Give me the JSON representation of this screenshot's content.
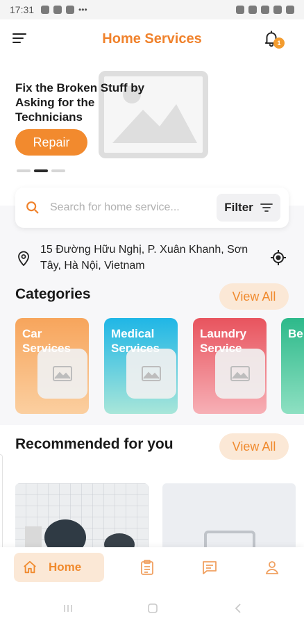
{
  "status_bar": {
    "time": "17:31"
  },
  "header": {
    "title": "Home Services",
    "notification_count": "1"
  },
  "banner": {
    "headline": "Fix the Broken Stuff by Asking for the Technicians",
    "cta_label": "Repair"
  },
  "search": {
    "placeholder": "Search for home service...",
    "filter_label": "Filter"
  },
  "location": {
    "address": "15 Đường Hữu Nghị, P. Xuân Khanh, Sơn Tây, Hà Nội, Vietnam"
  },
  "categories": {
    "title": "Categories",
    "view_all_label": "View All",
    "items": [
      {
        "label": "Car Services",
        "color_top": "#f7a55c",
        "color_bottom": "#fbcfa0"
      },
      {
        "label": "Medical Services",
        "color_top": "#1fb6e6",
        "color_bottom": "#a8e6d9"
      },
      {
        "label": "Laundry Service",
        "color_top": "#e8545e",
        "color_bottom": "#f7b0b6"
      },
      {
        "label": "Be Ha",
        "color_top": "#2db98a",
        "color_bottom": "#8ee0c2"
      }
    ]
  },
  "recommended": {
    "title": "Recommended for you",
    "view_all_label": "View All"
  },
  "bottom_nav": {
    "home_label": "Home",
    "items": [
      "home-icon",
      "bookings-clipboard-icon",
      "chat-icon",
      "profile-icon"
    ]
  },
  "colors": {
    "accent": "#f0822c",
    "accent_soft": "#fbe8d6"
  }
}
